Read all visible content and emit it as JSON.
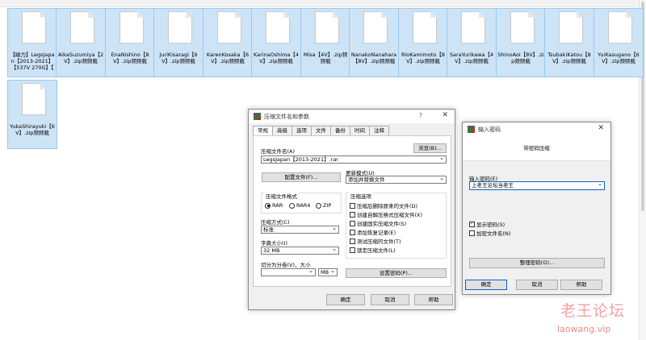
{
  "files": [
    {
      "name": "【磁力】LegsJapan【2013-2021】【537V 270G】【"
    },
    {
      "name": "AikaSuzumiya【2V】.zip频频载"
    },
    {
      "name": "EnaNishino【8V】.zip频频载"
    },
    {
      "name": "JuriKisaragi【6V】.zip频频载"
    },
    {
      "name": "KarenKosaka【6V】.zip频频载"
    },
    {
      "name": "KarinaOshima【4V】.zip频频载"
    },
    {
      "name": "Misa【4V】.zip频频载"
    },
    {
      "name": "NanakoNanahara【8V】.zip频频载"
    },
    {
      "name": "RioKamimoto【8V】.zip频频载"
    },
    {
      "name": "SaraYurikawa【4V】.zip频频载"
    },
    {
      "name": "ShinoAoi【8V】.zip频频载"
    },
    {
      "name": "TsubakiKatou【8V】.zip频频载"
    },
    {
      "name": "YuiKasugano【6V】.zip频频载"
    },
    {
      "name": "YukaShirayuki【6V】.zip频频载"
    }
  ],
  "archive_dialog": {
    "title": "压缩文件名和参数",
    "help_glyph": "?",
    "close_glyph": "✕",
    "tabs": [
      "常规",
      "高级",
      "选项",
      "文件",
      "备份",
      "时间",
      "注释"
    ],
    "archive_name_label": "压缩文件名(A)",
    "browse_button": "浏览(B)...",
    "archive_name_value": "LegsJapan【2013-2021】.rar",
    "profiles_button": "配置文件(F)...",
    "update_mode_label": "更新模式(U)",
    "update_mode_value": "添加并替换文件",
    "format_label": "压缩文件格式",
    "format_options": [
      "RAR",
      "RAR4",
      "ZIP"
    ],
    "options_label": "压缩选项",
    "options": [
      "压缩后删除原来的文件(D)",
      "创建自解压格式压缩文件(X)",
      "创建固实压缩文件(S)",
      "添加恢复记录(E)",
      "测试压缩的文件(T)",
      "锁定压缩文件(L)"
    ],
    "method_label": "压缩方式(C)",
    "method_value": "标准",
    "dict_label": "字典大小(I)",
    "dict_value": "32 MB",
    "split_label": "切分为分卷(V)，大小",
    "split_unit": "MB",
    "set_password_button": "设置密码(P)...",
    "ok_button": "确定",
    "cancel_button": "取消",
    "help_button": "帮助"
  },
  "password_dialog": {
    "title": "输入密码",
    "close_glyph": "✕",
    "header": "带密码压缩",
    "password_label": "输入密码(E)",
    "password_value": "上老王论坛当老王",
    "show_password": "显示密码(S)",
    "encrypt_names": "加密文件名(N)",
    "organize_button": "整理密码(O)...",
    "ok_button": "确定",
    "cancel_button": "取消",
    "help_button": "帮助"
  },
  "watermark": {
    "line1": "老王论坛",
    "line2": "laowang.vip"
  }
}
